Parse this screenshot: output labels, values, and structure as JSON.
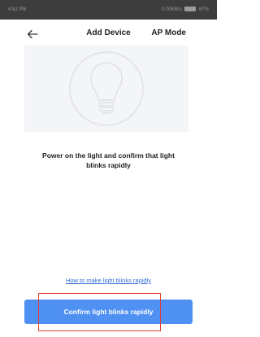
{
  "status_bar": {
    "time": "4:52 PM",
    "indicators": "0.00KB/s",
    "battery": "67%"
  },
  "nav": {
    "back_icon": "back-arrow-icon",
    "title": "Add Device",
    "right_action": "AP Mode"
  },
  "illustration": {
    "icon": "light-bulb-icon"
  },
  "instruction": {
    "text": "Power on the light and confirm that light blinks  rapidly"
  },
  "help_link": {
    "label": "How to make light blinks rapidly"
  },
  "confirm_button": {
    "label": "Confirm light blinks rapidly"
  },
  "colors": {
    "accent": "#4f90f3",
    "link": "#2f6bd8",
    "highlight": "#e23b3b",
    "status_bar": "#3d3d3d"
  }
}
